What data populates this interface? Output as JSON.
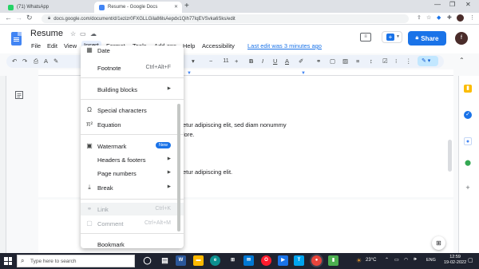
{
  "browser": {
    "tabs": [
      {
        "label": "(71) WhatsApp",
        "active": false
      },
      {
        "label": "Resume - Google Docs",
        "active": true
      }
    ],
    "new_tab": "+",
    "url": "docs.google.com/document/d/1ezizr0FXGLLGila86lsAepdx1Qih77IqEVSvka6Sks/edit"
  },
  "docs": {
    "title": "Resume",
    "menus": [
      "File",
      "Edit",
      "View",
      "Insert",
      "Format",
      "Tools",
      "Add-ons",
      "Help",
      "Accessibility"
    ],
    "last_edit": "Last edit was 3 minutes ago",
    "share_label": "Share",
    "avatar_initial": "f",
    "font_size": "11",
    "page1_text": [
      "etur adipiscing elit, sed diam nonummy",
      "lore.",
      "etur adipiscing elit."
    ]
  },
  "insert_menu": {
    "items": [
      {
        "label": "Date",
        "icon": "calendar-icon",
        "group": 0
      },
      {
        "label": "Footnote",
        "shortcut": "Ctrl+Alt+F",
        "group": 0
      },
      {
        "label": "Building blocks",
        "submenu": true,
        "group": 1
      },
      {
        "label": "Special characters",
        "icon": "omega-icon",
        "group": 2
      },
      {
        "label": "Equation",
        "icon": "pi-icon",
        "group": 2
      },
      {
        "label": "Watermark",
        "icon": "watermark-icon",
        "badge": "New",
        "group": 3
      },
      {
        "label": "Headers & footers",
        "submenu": true,
        "group": 3
      },
      {
        "label": "Page numbers",
        "submenu": true,
        "group": 3
      },
      {
        "label": "Break",
        "icon": "break-icon",
        "submenu": true,
        "group": 3
      },
      {
        "label": "Link",
        "icon": "link-icon",
        "shortcut": "Ctrl+K",
        "disabled": true,
        "group": 4
      },
      {
        "label": "Comment",
        "icon": "comment-icon",
        "shortcut": "Ctrl+Alt+M",
        "disabled": true,
        "group": 4
      },
      {
        "label": "Bookmark",
        "group": 5
      }
    ]
  },
  "taskbar": {
    "search_placeholder": "Type here to search",
    "weather": "23°C",
    "language": "ENG",
    "time": "12:59",
    "date": "19-02-2022"
  },
  "colors": {
    "accent": "#1a73e8",
    "docs_blue": "#4285f4",
    "taskbar": "#1f2330"
  }
}
